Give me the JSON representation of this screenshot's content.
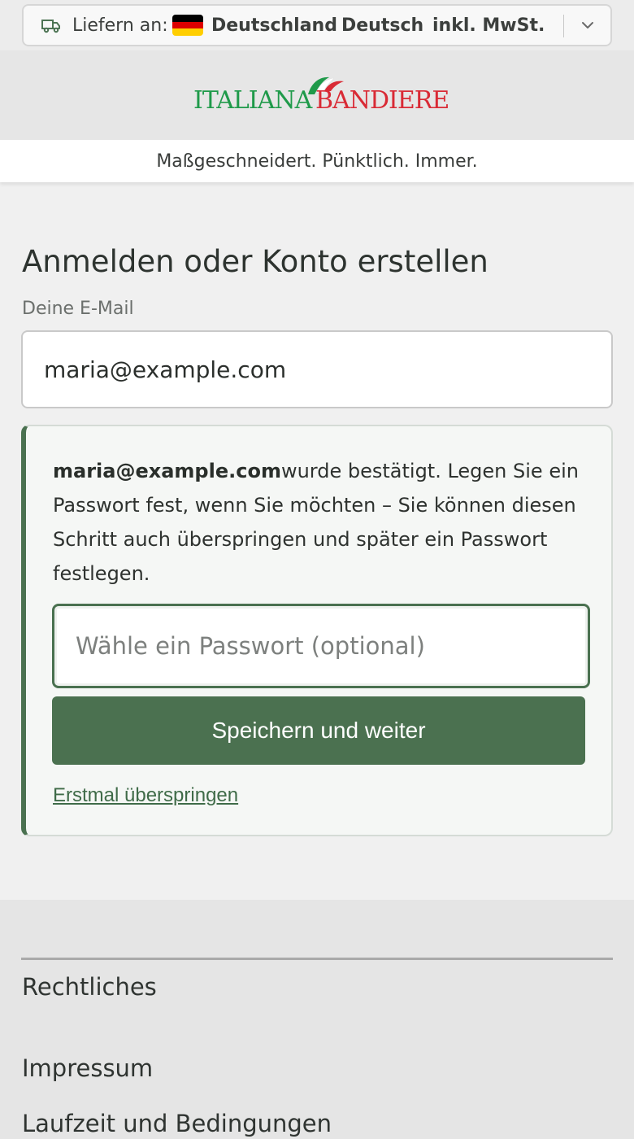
{
  "shipping_bar": {
    "deliver_label": "Liefern an:",
    "country": "Deutschland",
    "separator": "·",
    "language": "Deutsch",
    "tax_note": "inkl. MwSt.",
    "flag_colors": [
      "#000000",
      "#dd0000",
      "#ffce00"
    ]
  },
  "header": {
    "logo_part1": "ITALIANA",
    "logo_part2": "BANDIERE",
    "tagline": "Maßgeschneidert. Pünktlich. Immer."
  },
  "main": {
    "title": "Anmelden oder Konto erstellen",
    "email_label": "Deine E-Mail",
    "email_value": "maria@example.com",
    "notice": {
      "email": "maria@example.com",
      "message": "wurde bestätigt. Legen Sie ein Passwort fest, wenn Sie möchten – Sie können diesen Schritt auch überspringen und später ein Passwort festlegen."
    },
    "password_placeholder": "Wähle ein Passwort (optional)",
    "save_button": "Speichern und weiter",
    "skip_link": "Erstmal überspringen"
  },
  "footer": {
    "heading": "Rechtliches",
    "links": [
      "Impressum",
      "Laufzeit und Bedingungen"
    ]
  },
  "colors": {
    "accent_green": "#4b7150",
    "logo_green": "#1f9a4a",
    "logo_red": "#d92a35"
  }
}
